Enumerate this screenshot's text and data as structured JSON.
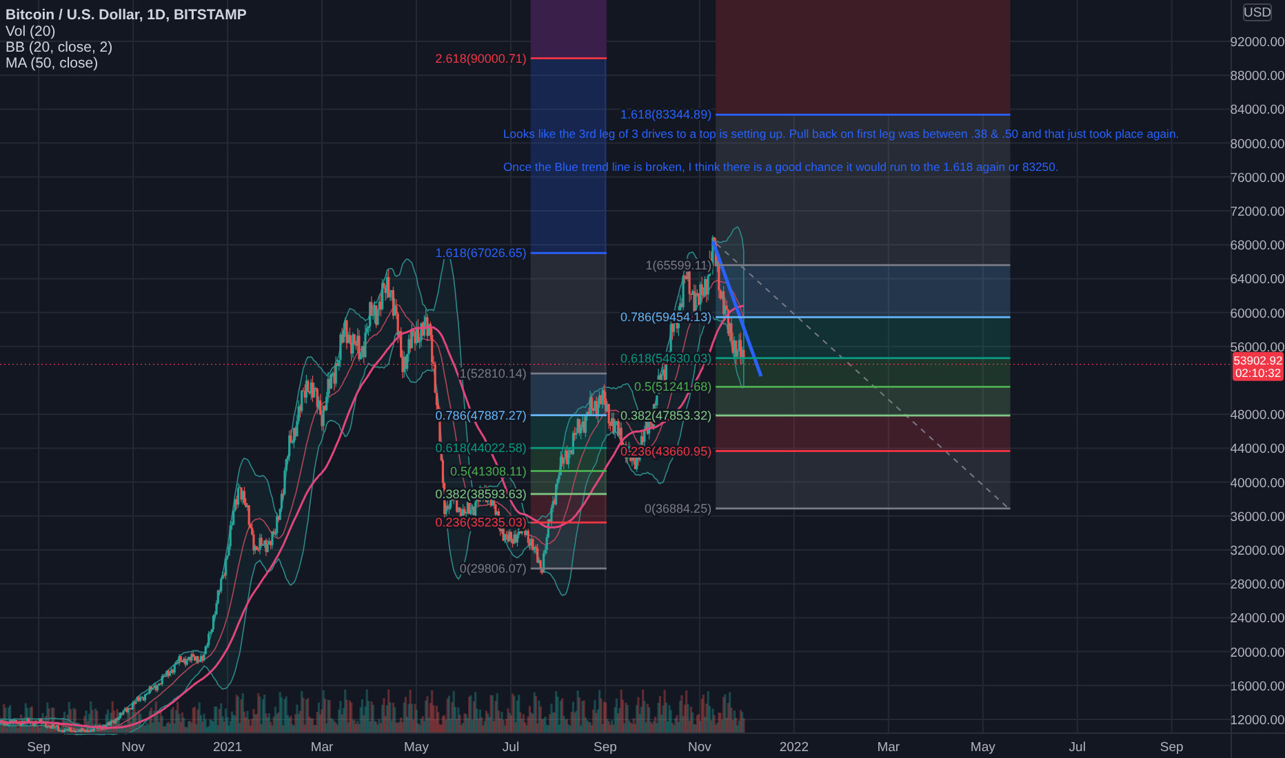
{
  "legend": {
    "title": "Bitcoin / U.S. Dollar, 1D, BITSTAMP",
    "indicators": [
      "Vol (20)",
      "BB (20, close, 2)",
      "MA (50, close)"
    ]
  },
  "price_axis": {
    "currency": "USD",
    "ticks": [
      "92000.00",
      "88000.00",
      "84000.00",
      "80000.00",
      "76000.00",
      "72000.00",
      "68000.00",
      "64000.00",
      "60000.00",
      "56000.00",
      "48000.00",
      "44000.00",
      "40000.00",
      "36000.00",
      "32000.00",
      "28000.00",
      "24000.00",
      "20000.00",
      "16000.00",
      "12000.00"
    ],
    "last_price": "53902.92",
    "countdown": "02:10:32"
  },
  "time_axis": {
    "ticks": [
      "Sep",
      "Nov",
      "2021",
      "Mar",
      "May",
      "Jul",
      "Sep",
      "Nov",
      "2022",
      "Mar",
      "May",
      "Jul",
      "Sep"
    ]
  },
  "fib_retracements": [
    {
      "levels": [
        {
          "label": "2.618(90000.71)",
          "color": "#f23645"
        },
        {
          "label": "1.618(67026.65)",
          "color": "#2962ff"
        },
        {
          "label": "1(52810.14)",
          "color": "#787b86"
        },
        {
          "label": "0.786(47887.27)",
          "color": "#64b5f6"
        },
        {
          "label": "0.618(44022.58)",
          "color": "#089981"
        },
        {
          "label": "0.5(41308.11)",
          "color": "#4caf50"
        },
        {
          "label": "0.382(38593.63)",
          "color": "#81c784"
        },
        {
          "label": "0.236(35235.03)",
          "color": "#f23645"
        },
        {
          "label": "0(29806.07)",
          "color": "#787b86"
        }
      ]
    },
    {
      "levels": [
        {
          "label": "1.618(83344.89)",
          "color": "#2962ff"
        },
        {
          "label": "1(65599.11)",
          "color": "#787b86"
        },
        {
          "label": "0.786(59454.13)",
          "color": "#64b5f6"
        },
        {
          "label": "0.618(54630.03)",
          "color": "#089981"
        },
        {
          "label": "0.5(51241.68)",
          "color": "#4caf50"
        },
        {
          "label": "0.382(47853.32)",
          "color": "#81c784"
        },
        {
          "label": "0.236(43660.95)",
          "color": "#f23645"
        },
        {
          "label": "0(36884.25)",
          "color": "#787b86"
        }
      ]
    }
  ],
  "note": {
    "lines": [
      "Looks like the 3rd leg of 3 drives to a top is setting up. Pull back on first leg was between .38 & .50 and that just took place again.",
      "Once the Blue trend line is broken, I think there is a good chance it would run to the 1.618 again or 83250."
    ]
  }
}
